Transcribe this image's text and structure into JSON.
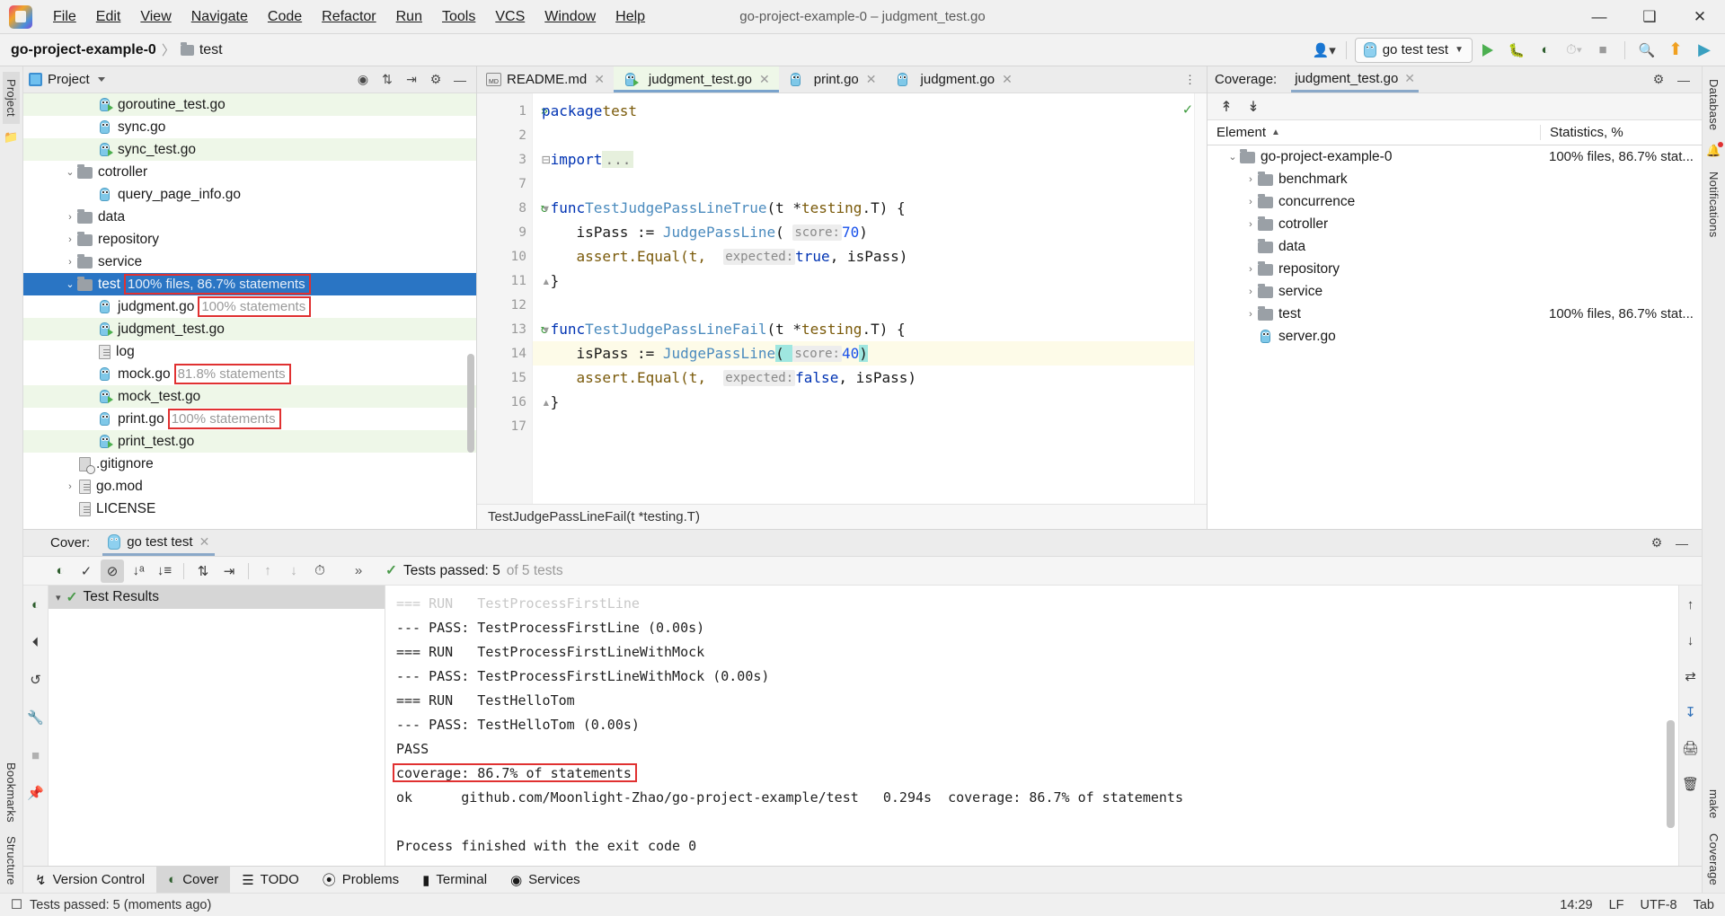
{
  "window": {
    "title": "go-project-example-0 – judgment_test.go",
    "logo_icon": "goland-logo-icon",
    "minimize_label": "—",
    "maximize_label": "❐",
    "close_label": "✕"
  },
  "menu": [
    {
      "label": "File",
      "mnemonic": "F"
    },
    {
      "label": "Edit",
      "mnemonic": "E"
    },
    {
      "label": "View",
      "mnemonic": "V"
    },
    {
      "label": "Navigate",
      "mnemonic": "N"
    },
    {
      "label": "Code",
      "mnemonic": "C"
    },
    {
      "label": "Refactor",
      "mnemonic": "R"
    },
    {
      "label": "Run",
      "mnemonic": "u"
    },
    {
      "label": "Tools",
      "mnemonic": "T"
    },
    {
      "label": "VCS",
      "mnemonic": "S"
    },
    {
      "label": "Window",
      "mnemonic": "W"
    },
    {
      "label": "Help",
      "mnemonic": "H"
    }
  ],
  "navbar": {
    "project": "go-project-example-0",
    "separator": "〉",
    "crumb": "test",
    "run_config": "go test test",
    "icons": {
      "account": "account-icon",
      "run": "run-icon",
      "debug": "debug-icon",
      "coverage": "run-with-coverage-icon",
      "profile": "profiler-icon",
      "stop": "stop-icon",
      "search": "search-everywhere-icon",
      "updates": "updates-icon",
      "ide": "ide-icon"
    }
  },
  "left_rail": {
    "tabs": [
      "Project"
    ],
    "icons": [
      "structure-folder-icon"
    ]
  },
  "right_rail": {
    "tabs": [
      "Database",
      "Notifications"
    ],
    "icons": [
      "database-icon",
      "notifications-bell-icon"
    ]
  },
  "left_rail_bottom": {
    "tabs": [
      "Bookmarks",
      "Structure"
    ]
  },
  "right_rail_bottom": {
    "tabs": [
      "make",
      "Coverage"
    ]
  },
  "project_tool": {
    "title": "Project",
    "actions": [
      "locate-icon",
      "expand-all-icon",
      "collapse-all-icon",
      "settings-gear-icon",
      "hide-icon"
    ],
    "tree": [
      {
        "label": "goroutine_test.go",
        "indent": 3,
        "icon": "go-test-file-icon",
        "covered": true,
        "arrow": "",
        "badge": ""
      },
      {
        "label": "sync.go",
        "indent": 3,
        "icon": "go-file-icon",
        "covered": false,
        "arrow": "",
        "badge": ""
      },
      {
        "label": "sync_test.go",
        "indent": 3,
        "icon": "go-test-file-icon",
        "covered": true,
        "arrow": "",
        "badge": ""
      },
      {
        "label": "cotroller",
        "indent": 2,
        "icon": "folder-icon",
        "covered": false,
        "arrow": "v",
        "badge": ""
      },
      {
        "label": "query_page_info.go",
        "indent": 3,
        "icon": "go-file-icon",
        "covered": false,
        "arrow": "",
        "badge": ""
      },
      {
        "label": "data",
        "indent": 2,
        "icon": "folder-icon",
        "covered": false,
        "arrow": ">",
        "badge": ""
      },
      {
        "label": "repository",
        "indent": 2,
        "icon": "folder-icon",
        "covered": false,
        "arrow": ">",
        "badge": ""
      },
      {
        "label": "service",
        "indent": 2,
        "icon": "folder-icon",
        "covered": false,
        "arrow": ">",
        "badge": ""
      },
      {
        "label": "test",
        "indent": 2,
        "icon": "folder-icon",
        "covered": false,
        "arrow": "v",
        "badge": "100% files, 86.7% statements",
        "selected": true,
        "highlight": true
      },
      {
        "label": "judgment.go",
        "indent": 3,
        "icon": "go-file-icon",
        "covered": false,
        "arrow": "",
        "badge": "100% statements",
        "highlight": true
      },
      {
        "label": "judgment_test.go",
        "indent": 3,
        "icon": "go-test-file-icon",
        "covered": true,
        "arrow": "",
        "badge": ""
      },
      {
        "label": "log",
        "indent": 3,
        "icon": "document-icon",
        "covered": false,
        "arrow": "",
        "badge": ""
      },
      {
        "label": "mock.go",
        "indent": 3,
        "icon": "go-file-icon",
        "covered": false,
        "arrow": "",
        "badge": "81.8% statements",
        "highlight": true
      },
      {
        "label": "mock_test.go",
        "indent": 3,
        "icon": "go-test-file-icon",
        "covered": true,
        "arrow": "",
        "badge": ""
      },
      {
        "label": "print.go",
        "indent": 3,
        "icon": "go-file-icon",
        "covered": false,
        "arrow": "",
        "badge": "100% statements",
        "highlight": true
      },
      {
        "label": "print_test.go",
        "indent": 3,
        "icon": "go-test-file-icon",
        "covered": true,
        "arrow": "",
        "badge": ""
      },
      {
        "label": ".gitignore",
        "indent": 2,
        "icon": "gitignore-icon",
        "covered": false,
        "arrow": "",
        "badge": ""
      },
      {
        "label": "go.mod",
        "indent": 2,
        "icon": "document-icon",
        "covered": false,
        "arrow": ">",
        "badge": ""
      },
      {
        "label": "LICENSE",
        "indent": 2,
        "icon": "document-icon",
        "covered": false,
        "arrow": "",
        "badge": ""
      }
    ]
  },
  "editor": {
    "tabs": [
      {
        "label": "README.md",
        "icon": "markdown-file-icon",
        "active": false
      },
      {
        "label": "judgment_test.go",
        "icon": "go-test-file-icon",
        "active": true
      },
      {
        "label": "print.go",
        "icon": "go-file-icon",
        "active": false
      },
      {
        "label": "judgment.go",
        "icon": "go-file-icon",
        "active": false
      }
    ],
    "more_icon": "editor-tabs-more-icon",
    "inspection_icon": "inspection-ok-icon",
    "breadcrumb": "TestJudgePassLineFail(t *testing.T)",
    "lines": [
      {
        "n": "1",
        "gutter_icon": "run-all-tests-icon"
      },
      {
        "n": "2",
        "gutter_icon": ""
      },
      {
        "n": "3",
        "gutter_icon": ""
      },
      {
        "n": "7",
        "gutter_icon": ""
      },
      {
        "n": "8",
        "gutter_icon": "run-test-icon"
      },
      {
        "n": "9",
        "gutter_icon": ""
      },
      {
        "n": "10",
        "gutter_icon": ""
      },
      {
        "n": "11",
        "gutter_icon": ""
      },
      {
        "n": "12",
        "gutter_icon": ""
      },
      {
        "n": "13",
        "gutter_icon": "run-test-icon"
      },
      {
        "n": "14",
        "gutter_icon": "",
        "current": true
      },
      {
        "n": "15",
        "gutter_icon": ""
      },
      {
        "n": "16",
        "gutter_icon": ""
      },
      {
        "n": "17",
        "gutter_icon": ""
      }
    ],
    "code": {
      "l1_kw": "package",
      "l1_name": "test",
      "l3_kw": "import",
      "l3_dots": "...",
      "l8_kw": "func",
      "l8_name": "TestJudgePassLineTrue",
      "l8_sig_a": "(t *",
      "l8_type": "testing",
      "l8_sig_b": ".T) {",
      "l9_var": "    isPass := ",
      "l9_call": "JudgePassLine",
      "l9_open": "( ",
      "l9_hint": "score:",
      "l9_val": "70",
      "l9_close": ")",
      "l10_a": "    assert.Equal(t,  ",
      "l10_hint": "expected:",
      "l10_true": "true",
      "l10_b": ", isPass)",
      "l11": "}",
      "l13_kw": "func",
      "l13_name": "TestJudgePassLineFail",
      "l14_var": "    isPass := ",
      "l14_call": "JudgePassLine",
      "l14_open": "( ",
      "l14_hint": "score:",
      "l14_val": "40",
      "l14_close": ")",
      "l15_a": "    assert.Equal(t,  ",
      "l15_hint": "expected:",
      "l15_false": "false",
      "l15_b": ", isPass)",
      "l16": "}"
    }
  },
  "coverage_tool": {
    "label": "Coverage:",
    "tab": "judgment_test.go",
    "tab_icon": "coverage-tab-icon",
    "toolbar": [
      "collapse-to-top-icon",
      "expand-to-bottom-icon"
    ],
    "settings_icon": "settings-gear-icon",
    "hide_icon": "hide-icon",
    "columns": {
      "element": "Element",
      "sort_icon": "sort-asc-icon",
      "statistics": "Statistics, %"
    },
    "rows": [
      {
        "label": "go-project-example-0",
        "indent": 1,
        "arrow": "v",
        "stat": "100% files, 86.7% stat...",
        "icon": "folder-icon"
      },
      {
        "label": "benchmark",
        "indent": 2,
        "arrow": ">",
        "stat": "",
        "icon": "folder-icon"
      },
      {
        "label": "concurrence",
        "indent": 2,
        "arrow": ">",
        "stat": "",
        "icon": "folder-icon"
      },
      {
        "label": "cotroller",
        "indent": 2,
        "arrow": ">",
        "stat": "",
        "icon": "folder-icon"
      },
      {
        "label": "data",
        "indent": 2,
        "arrow": "",
        "stat": "",
        "icon": "folder-icon"
      },
      {
        "label": "repository",
        "indent": 2,
        "arrow": ">",
        "stat": "",
        "icon": "folder-icon"
      },
      {
        "label": "service",
        "indent": 2,
        "arrow": ">",
        "stat": "",
        "icon": "folder-icon"
      },
      {
        "label": "test",
        "indent": 2,
        "arrow": ">",
        "stat": "100% files, 86.7% stat...",
        "icon": "folder-icon"
      },
      {
        "label": "server.go",
        "indent": 2,
        "arrow": "",
        "stat": "",
        "icon": "go-file-icon"
      }
    ]
  },
  "run_panel": {
    "label": "Cover:",
    "tab": "go test test",
    "tab_icon": "go-test-icon",
    "settings_icon": "settings-gear-icon",
    "hide_icon": "hide-icon",
    "toolbar_icons": [
      "rerun-coverage-icon",
      "show-passed-icon",
      "hide-ignored-icon",
      "sort-alphabetically-icon",
      "sort-by-duration-icon",
      "expand-all-icon",
      "collapse-all-icon",
      "prev-failed-icon",
      "next-failed-icon",
      "history-icon",
      "more-icon"
    ],
    "status_icon": "tests-passed-check-icon",
    "status_text": "Tests passed: 5",
    "status_suffix": "of 5 tests",
    "tree_root": "Test Results",
    "tree_root_icon": "tests-passed-check-icon",
    "console": [
      "=== RUN   TestProcessFirstLine",
      "--- PASS: TestProcessFirstLine (0.00s)",
      "=== RUN   TestProcessFirstLineWithMock",
      "--- PASS: TestProcessFirstLineWithMock (0.00s)",
      "=== RUN   TestHelloTom",
      "--- PASS: TestHelloTom (0.00s)",
      "PASS",
      "coverage: 86.7% of statements",
      "ok      github.com/Moonlight-Zhao/go-project-example/test   0.294s  coverage: 86.7% of statements",
      "",
      "Process finished with the exit code 0"
    ],
    "highlighted_console_line": "coverage: 86.7% of statements"
  },
  "tool_tabs": [
    {
      "label": "Version Control",
      "icon": "version-control-icon",
      "active": false
    },
    {
      "label": "Cover",
      "icon": "coverage-icon",
      "active": true
    },
    {
      "label": "TODO",
      "icon": "todo-icon",
      "active": false
    },
    {
      "label": "Problems",
      "icon": "problems-icon",
      "active": false
    },
    {
      "label": "Terminal",
      "icon": "terminal-icon",
      "active": false
    },
    {
      "label": "Services",
      "icon": "services-icon",
      "active": false
    }
  ],
  "statusbar": {
    "icon": "notification-icon",
    "message": "Tests passed: 5 (moments ago)",
    "time": "14:29",
    "line_separator": "LF",
    "encoding": "UTF-8",
    "indent": "Tab"
  },
  "colors": {
    "selection_blue": "#2a75c4",
    "covered_green": "#eef7e8",
    "highlight_red": "#e03131",
    "accent_run_green": "#4caf50"
  }
}
